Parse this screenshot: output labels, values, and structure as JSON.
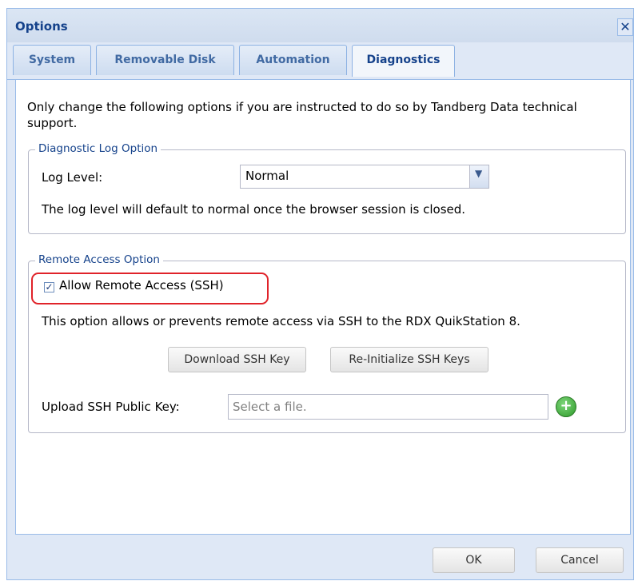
{
  "window": {
    "title": "Options",
    "close_glyph": "✕"
  },
  "tabs": [
    {
      "label": "System"
    },
    {
      "label": "Removable Disk"
    },
    {
      "label": "Automation"
    },
    {
      "label": "Diagnostics"
    }
  ],
  "intro_text": "Only change the following options if you are instructed to do so by Tandberg Data technical support.",
  "diagnostic_log": {
    "legend": "Diagnostic Log Option",
    "log_level_label": "Log Level:",
    "log_level_value": "Normal",
    "note": "The log level will default to normal once the browser session is closed."
  },
  "remote_access": {
    "legend": "Remote Access Option",
    "checkbox_label": "Allow Remote Access (SSH)",
    "checked": true,
    "description": "This option allows or prevents remote access via SSH to the RDX QuikStation 8.",
    "download_key_label": "Download SSH Key",
    "reinit_keys_label": "Re-Initialize SSH Keys",
    "upload_label": "Upload SSH Public Key:",
    "upload_placeholder": "Select a file."
  },
  "footer": {
    "ok_label": "OK",
    "cancel_label": "Cancel"
  },
  "colors": {
    "accent": "#15428b",
    "highlight": "#e0232a",
    "add_green": "#2e9a2a"
  },
  "icons": {
    "dropdown": "chevron-down-icon",
    "add": "plus-circle-icon",
    "close": "close-icon"
  }
}
